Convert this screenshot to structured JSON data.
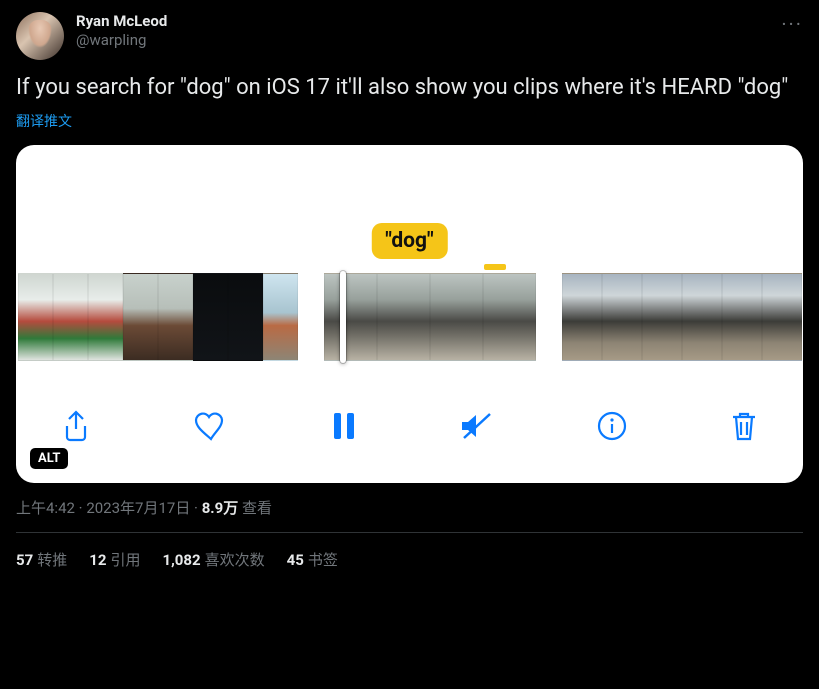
{
  "author": {
    "display_name": "Ryan McLeod",
    "handle": "@warpling"
  },
  "body": "If you search for \"dog\" on iOS 17 it'll also show you clips where it's HEARD \"dog\"",
  "translate_label": "翻译推文",
  "media": {
    "tag_label": "\"dog\"",
    "alt_badge": "ALT"
  },
  "meta": {
    "time": "上午4:42",
    "date": "2023年7月17日",
    "views_count": "8.9万",
    "views_label": "查看"
  },
  "stats": {
    "retweets": {
      "count": "57",
      "label": "转推"
    },
    "quotes": {
      "count": "12",
      "label": "引用"
    },
    "likes": {
      "count": "1,082",
      "label": "喜欢次数"
    },
    "bookmarks": {
      "count": "45",
      "label": "书签"
    }
  }
}
